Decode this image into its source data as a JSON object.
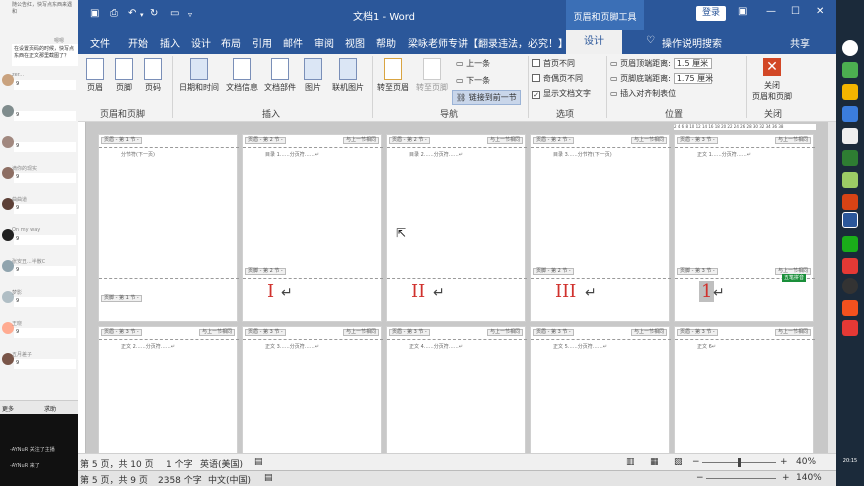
{
  "chat": {
    "top_text": "嗯嗯",
    "top_text2": "在设置页码的时候",
    "banner1": "随公告红，快写点东西来遇和",
    "bubble": "在设置页码的时候，快写点东西在正文那里截图了？",
    "messages": [
      {
        "name": "zer...",
        "count": "9"
      },
      {
        "name": "",
        "count": "9"
      },
      {
        "name": "",
        "count": "9"
      },
      {
        "name": "滴你的现实",
        "count": "9"
      },
      {
        "name": "曲曲道",
        "count": "9"
      },
      {
        "name": "On my way",
        "count": "9"
      },
      {
        "name": "张安丑...半散C",
        "count": "9"
      },
      {
        "name": "梦影",
        "count": "9"
      },
      {
        "name": "王晓",
        "count": "9"
      },
      {
        "name": "五月差子",
        "count": "9"
      }
    ],
    "tool_left": "更多",
    "tool_right": "求助",
    "footer_lines": [
      "-AYNuR 关注了主播",
      "-AYNuR 来了"
    ]
  },
  "window": {
    "title": "文档1 - Word",
    "tool_title": "页眉和页脚工具",
    "login": "登录"
  },
  "tabs": [
    "文件",
    "开始",
    "插入",
    "设计",
    "布局",
    "引用",
    "邮件",
    "审阅",
    "视图",
    "帮助",
    "梁咏老师专讲【翻录违法，必究！】"
  ],
  "active_tab": "设计",
  "tell_me": "操作说明搜索",
  "share": "共享",
  "ribbon": {
    "group1": {
      "label": "页眉和页脚",
      "items": [
        "页眉",
        "页脚",
        "页码"
      ]
    },
    "group2": {
      "label": "插入",
      "items": [
        "日期和时间",
        "文档信息",
        "文档部件",
        "图片",
        "联机图片"
      ]
    },
    "group3": {
      "label": "导航",
      "items": [
        "转至页眉",
        "转至页脚"
      ],
      "small": [
        "上一条",
        "下一条",
        "链接到前一节"
      ]
    },
    "group4": {
      "label": "选项",
      "checks": [
        "首页不同",
        "奇偶页不同",
        "显示文档文字"
      ],
      "checked": [
        false,
        false,
        true
      ]
    },
    "group5": {
      "label": "位置",
      "rows": [
        {
          "label": "页眉顶端距离:",
          "value": "1.5 厘米"
        },
        {
          "label": "页脚底端距离:",
          "value": "1.75 厘米"
        },
        {
          "label": "插入对齐制表位",
          "value": ""
        }
      ]
    },
    "group6": {
      "label": "关闭",
      "item": "关闭\n页眉和页脚"
    }
  },
  "ruler_text": "2 4 6 8 10 12 14 16 18 20 22 24 26 28 30 32 34 36 38",
  "pages_top": [
    {
      "hdr": "页眉 - 第 1 节 -",
      "hdr_right": "",
      "text": "分节符(下一页)",
      "ftr": "页脚 - 第 1 节 -",
      "ftr_right": "",
      "num": ""
    },
    {
      "hdr": "页眉 - 第 2 节 -",
      "hdr_right": "与上一节相同",
      "text": "目录 1……分页符……↵",
      "ftr": "页脚 - 第 2 节 -",
      "ftr_right": "",
      "num": "I"
    },
    {
      "hdr": "页眉 - 第 2 节 -",
      "hdr_right": "与上一节相同",
      "text": "目录 2……分页符……↵",
      "ftr": "",
      "ftr_right": "",
      "num": "II"
    },
    {
      "hdr": "页眉 - 第 2 节 -",
      "hdr_right": "与上一节相同",
      "text": "目录 3……分节符(下一页)",
      "ftr": "页脚 - 第 2 节 -",
      "ftr_right": "",
      "num": "III"
    },
    {
      "hdr": "页眉 - 第 3 节 -",
      "hdr_right": "与上一节相同",
      "text": "正文 1……分页符……↵",
      "ftr": "页脚 - 第 3 节 -",
      "ftr_right": "与上一节相同",
      "num": "1"
    }
  ],
  "pages_bottom": [
    {
      "hdr": "页眉 - 第 3 节 -",
      "hdr_right": "与上一节相同",
      "text": "正文 2……分页符……↵"
    },
    {
      "hdr": "页眉 - 第 3 节 -",
      "hdr_right": "与上一节相同",
      "text": "正文 3……分页符……↵"
    },
    {
      "hdr": "页眉 - 第 3 节 -",
      "hdr_right": "与上一节相同",
      "text": "正文 4……分页符……↵"
    },
    {
      "hdr": "页眉 - 第 3 节 -",
      "hdr_right": "与上一节相同",
      "text": "正文 5……分页符……↵"
    },
    {
      "hdr": "页眉 - 第 3 节 -",
      "hdr_right": "与上一节相同",
      "text": "正文 6↵"
    }
  ],
  "green_badge": "五笔拼音",
  "status": {
    "page": "第 5 页，共 10 页",
    "words": "1 个字",
    "lang": "英语(美国)",
    "zoom": "40%",
    "zoom_level": 0.4
  },
  "status2": {
    "page": "第 5 页，共 9 页",
    "words": "2358 个字",
    "lang": "中文(中国)",
    "zoom": "140%"
  },
  "clock": "20:15",
  "colors": {
    "word_blue": "#2b579a",
    "roman_red": "#d0312d",
    "close_red": "#d24726"
  }
}
